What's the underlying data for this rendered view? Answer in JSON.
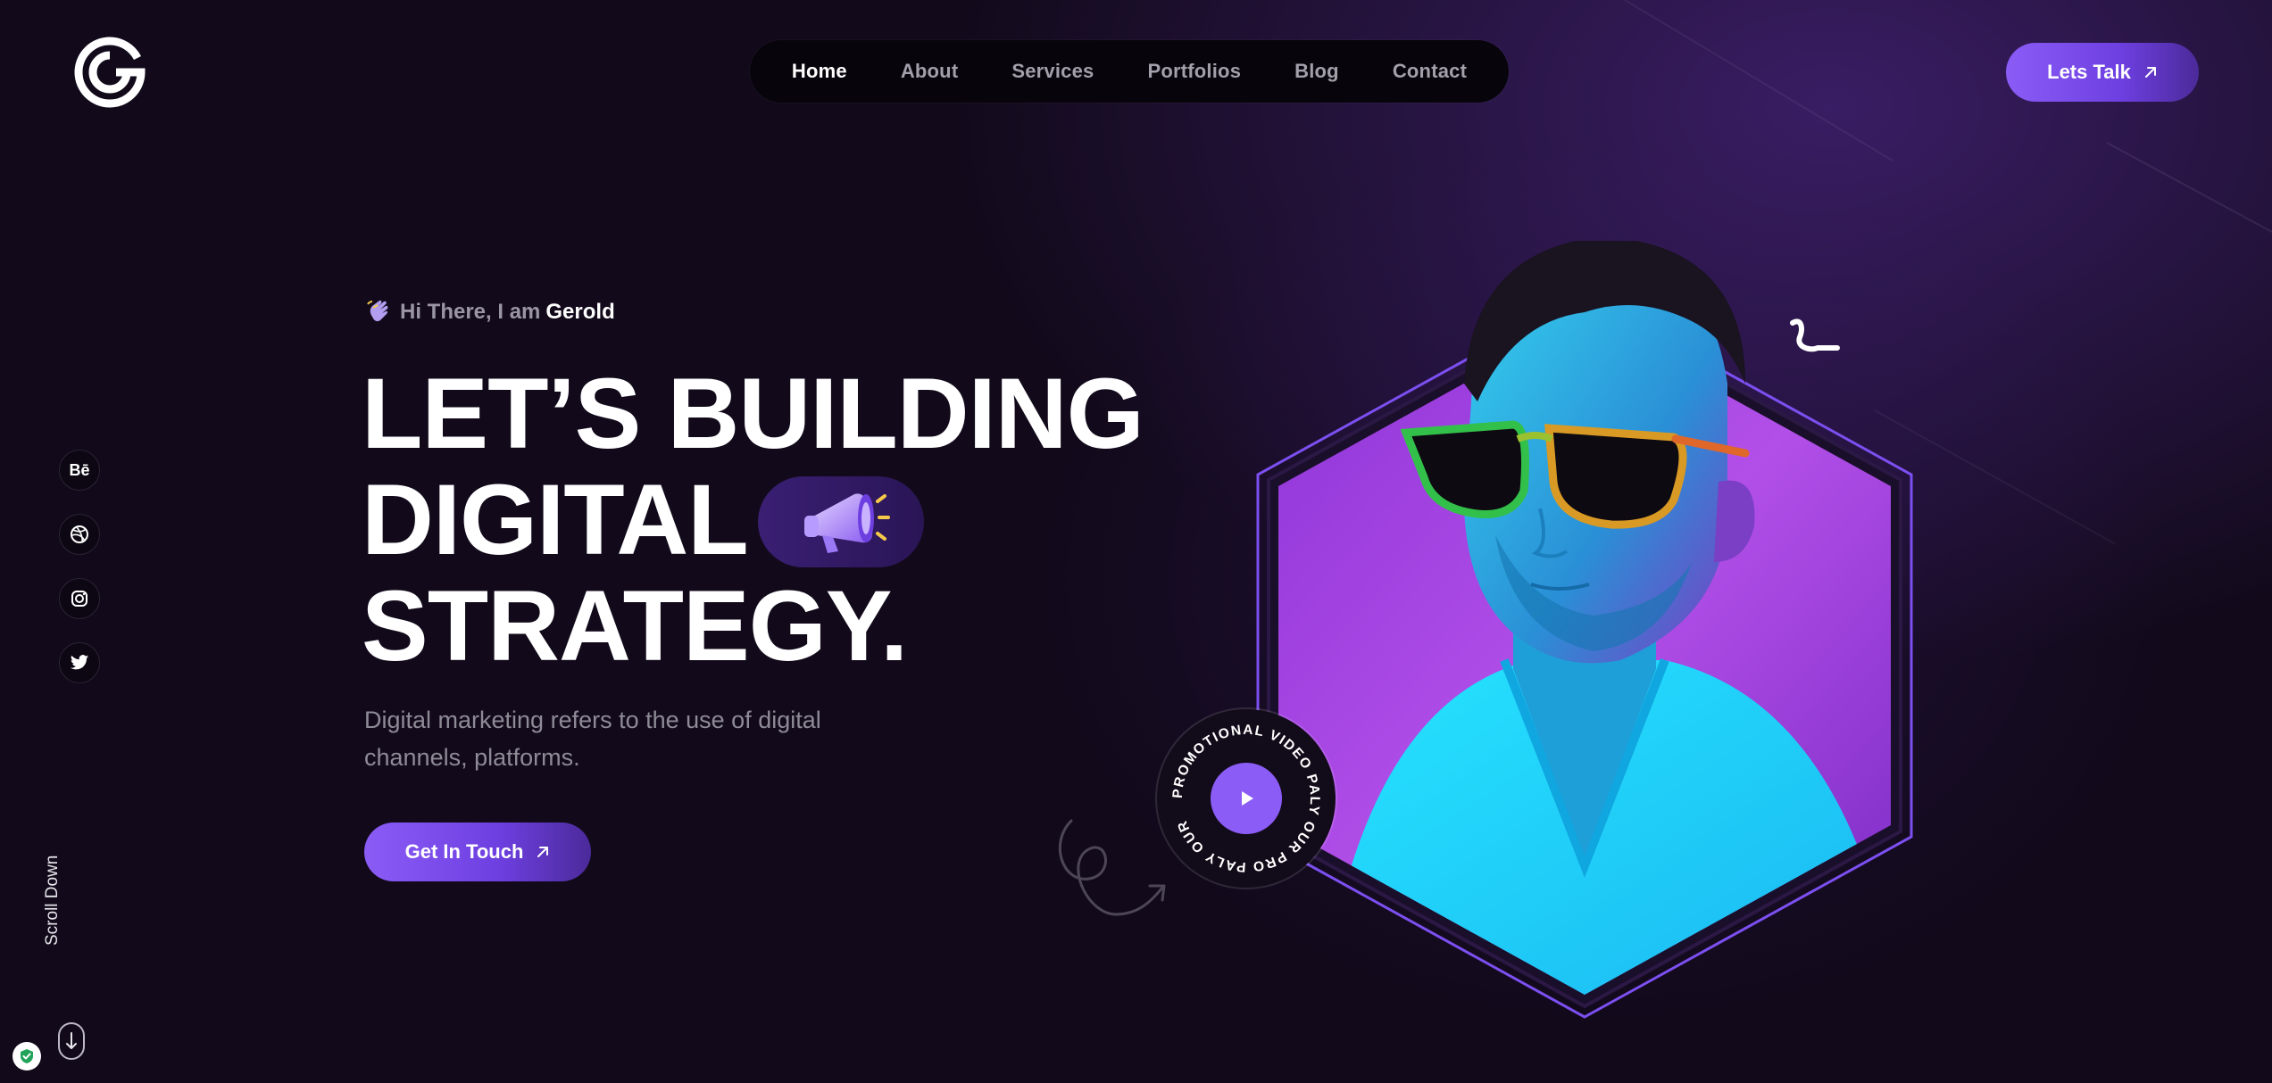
{
  "header": {
    "logo_icon": "g-ring-logo-icon",
    "nav": [
      {
        "label": "Home",
        "active": true
      },
      {
        "label": "About",
        "active": false
      },
      {
        "label": "Services",
        "active": false
      },
      {
        "label": "Portfolios",
        "active": false
      },
      {
        "label": "Blog",
        "active": false
      },
      {
        "label": "Contact",
        "active": false
      }
    ],
    "cta_label": "Lets Talk"
  },
  "social": [
    {
      "icon": "behance-icon",
      "glyph": "Bē"
    },
    {
      "icon": "dribbble-icon",
      "glyph": ""
    },
    {
      "icon": "instagram-icon",
      "glyph": ""
    },
    {
      "icon": "twitter-icon",
      "glyph": ""
    }
  ],
  "scroll": {
    "label": "Scroll Down"
  },
  "hero": {
    "greeting_prefix": "Hi There, I am",
    "greeting_name": "Gerold",
    "headline_line1": "LET’S BUILDING",
    "headline_line2": "DIGITAL",
    "headline_line3": "STRATEGY.",
    "description": "Digital marketing refers to the use of digital channels, platforms.",
    "cta_label": "Get In Touch"
  },
  "promo": {
    "ring_text": "PROMOTIONAL VIDEO PALY OUR PRO PALY OUR "
  },
  "colors": {
    "background": "#120a1b",
    "accent": "#8b5cf6",
    "nav_bg": "#07050b",
    "muted_text": "#8e8a96"
  }
}
